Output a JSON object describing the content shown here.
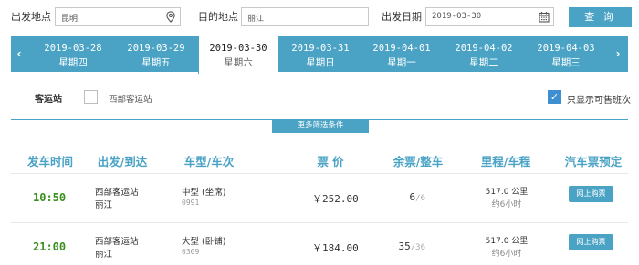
{
  "search": {
    "from_label": "出发地点",
    "from_value": "昆明",
    "to_label": "目的地点",
    "to_value": "丽江",
    "date_label": "出发日期",
    "date_value": "2019-03-30",
    "query_label": "查 询"
  },
  "datebar": {
    "prev_icon": "‹",
    "next_icon": "›",
    "days": [
      {
        "date": "2019-03-28",
        "weekday": "星期四"
      },
      {
        "date": "2019-03-29",
        "weekday": "星期五"
      },
      {
        "date": "2019-03-30",
        "weekday": "星期六"
      },
      {
        "date": "2019-03-31",
        "weekday": "星期日"
      },
      {
        "date": "2019-04-01",
        "weekday": "星期一"
      },
      {
        "date": "2019-04-02",
        "weekday": "星期二"
      },
      {
        "date": "2019-04-03",
        "weekday": "星期三"
      }
    ],
    "active_index": 2
  },
  "filter": {
    "station_label": "客运站",
    "station_option": "西部客运站",
    "station_checked": false,
    "only_sale_label": "只显示可售班次",
    "only_sale_checked": true,
    "more_label": "更多筛选条件"
  },
  "table": {
    "headers": [
      "发车时间",
      "出发/到达",
      "车型/车次",
      "票 价",
      "余票/整车",
      "里程/车程",
      "汽车票预定"
    ],
    "rows": [
      {
        "time": "10:50",
        "from": "西部客运站",
        "to": "丽江",
        "type": "中型 (坐席)",
        "code": "0991",
        "price": "￥252.00",
        "seats": "6",
        "seats_total": "/6",
        "distance": "517.0 公里",
        "duration": "约6小时",
        "buy": "网上购票"
      },
      {
        "time": "21:00",
        "from": "西部客运站",
        "to": "丽江",
        "type": "大型 (卧铺)",
        "code": "0309",
        "price": "￥184.00",
        "seats": "35",
        "seats_total": "/36",
        "distance": "517.0 公里",
        "duration": "约6小时",
        "buy": "网上购票"
      }
    ]
  },
  "colors": {
    "accent": "#4aa3c4",
    "time_green": "#3a8f1c",
    "checkbox_blue": "#3d8fd1"
  }
}
